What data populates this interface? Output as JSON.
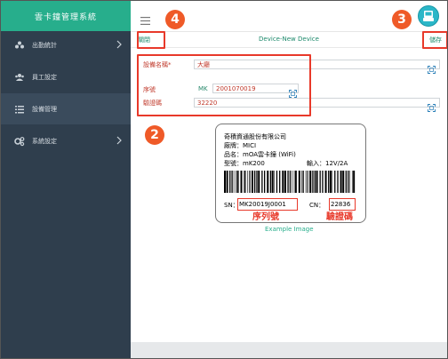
{
  "app": {
    "title": "雲卡鐘管理系統"
  },
  "sidebar": {
    "items": [
      {
        "label": "出勤統計",
        "icon": "team-icon"
      },
      {
        "label": "員工設定",
        "icon": "users-icon"
      },
      {
        "label": "設備管理",
        "icon": "list-icon"
      },
      {
        "label": "系統設定",
        "icon": "gears-icon"
      }
    ]
  },
  "toolbar": {
    "back_label": "關閉",
    "title": "Device-New Device",
    "save_label": "儲存"
  },
  "form": {
    "device_name_label": "設備名稱*",
    "device_name_value": "大廳",
    "serial_label": "序號",
    "serial_prefix": "MK",
    "serial_value": "2001070019",
    "code_label": "驗證碼",
    "code_value": "32220"
  },
  "annotations": {
    "n2": "2",
    "n3": "3",
    "n4": "4"
  },
  "label_card": {
    "company": "奇積資通股份有限公司",
    "brand": "廠牌：MICI",
    "product": "品名：mOA雲卡鐘 (WiFi)",
    "model": "型號：mK200",
    "input": "輸入：12V/2A",
    "sn_prefix": "SN：",
    "sn_value": "MK20019J0001",
    "cn_prefix": "CN：",
    "cn_value": "22836",
    "sn_caption": "序列號",
    "cn_caption": "驗證碼"
  },
  "example_label": "Example Image",
  "colors": {
    "brand": "#27ae8c",
    "sidebar": "#2f3e4d",
    "annotation": "#e8392a",
    "badge": "#ef5a28"
  }
}
